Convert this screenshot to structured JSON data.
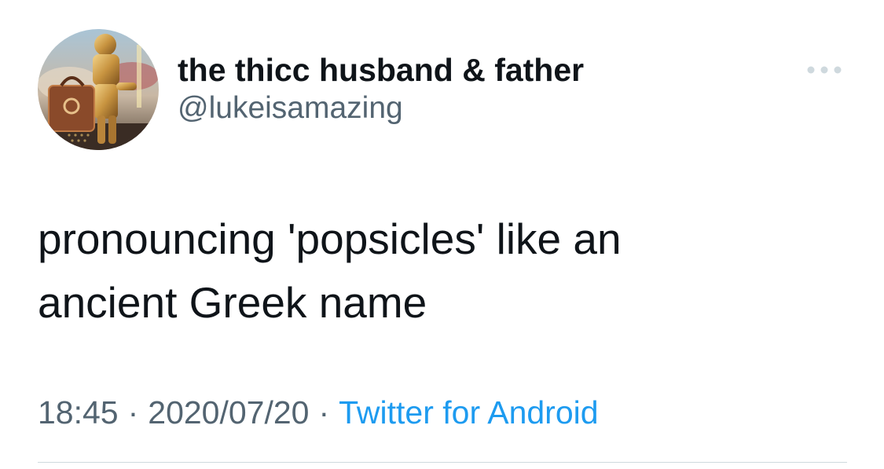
{
  "tweet": {
    "author": {
      "display_name": "the thicc husband & father",
      "handle": "@lukeisamazing"
    },
    "text": "pronouncing 'popsicles' like an\nancient Greek name",
    "time": "18:45",
    "date": "2020/07/20",
    "separator": "·",
    "source": "Twitter for Android"
  },
  "icons": {
    "avatar": "avatar-image",
    "more": "more-options-icon"
  },
  "colors": {
    "primary_text": "#0f1419",
    "secondary_text": "#536471",
    "link": "#1d9bf0",
    "divider": "#cfd9de"
  }
}
